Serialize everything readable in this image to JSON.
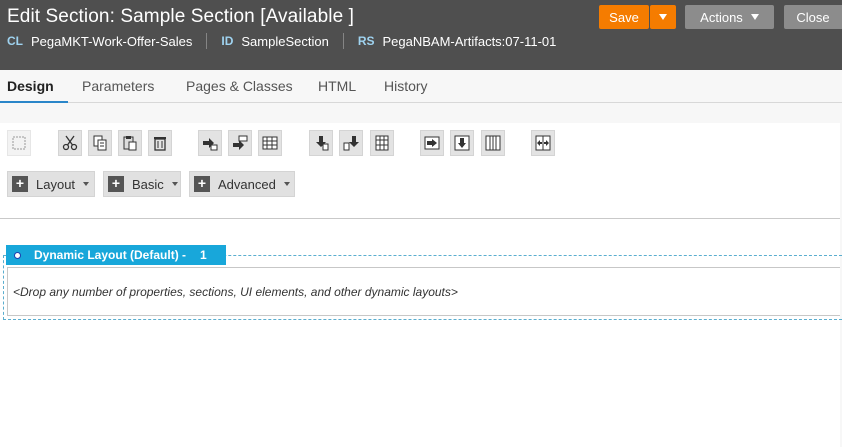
{
  "header": {
    "title": "Edit Section: Sample Section [Available ]",
    "meta": [
      {
        "key": "CL",
        "value": "PegaMKT-Work-Offer-Sales"
      },
      {
        "key": "ID",
        "value": "SampleSection"
      },
      {
        "key": "RS",
        "value": "PegaNBAM-Artifacts:07-11-01"
      }
    ],
    "save_label": "Save",
    "actions_label": "Actions",
    "close_label": "Close"
  },
  "tabs": [
    "Design",
    "Parameters",
    "Pages & Classes",
    "HTML",
    "History"
  ],
  "active_tab": "Design",
  "toolbar_icons": [
    "select-icon",
    "cut-icon",
    "copy-icon",
    "paste-icon",
    "delete-icon",
    "insert-row-after-icon",
    "insert-row-before-icon",
    "row-grid-icon",
    "insert-col-after-icon",
    "insert-col-before-icon",
    "col-grid-icon",
    "move-right-icon",
    "move-down-icon",
    "column-layout-icon",
    "merge-icon"
  ],
  "add_menus": [
    "Layout",
    "Basic",
    "Advanced"
  ],
  "layout": {
    "tab_label": "Dynamic Layout (Default) -",
    "count": "1",
    "drop_hint": "<Drop any number of properties, sections, UI elements, and other dynamic layouts>"
  },
  "colors": {
    "header_bg": "#4f4f4f",
    "save_orange": "#f57c00",
    "layout_tab_blue": "#18a7da",
    "active_tab_underline": "#2a86c9"
  }
}
